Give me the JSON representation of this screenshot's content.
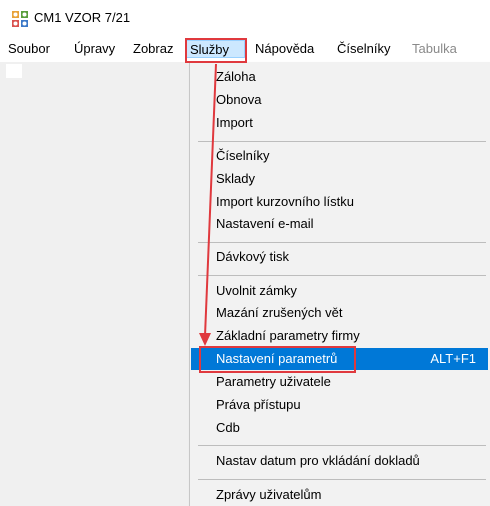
{
  "window": {
    "title": "CM1 VZOR 7/21",
    "icon": "app-grid-icon"
  },
  "menubar": {
    "items": [
      {
        "label": "Soubor",
        "state": "normal"
      },
      {
        "label": "Úpravy",
        "state": "normal"
      },
      {
        "label": "Zobraz",
        "state": "normal"
      },
      {
        "label": "Služby",
        "state": "open"
      },
      {
        "label": "Nápověda",
        "state": "normal"
      },
      {
        "label": "Číselníky",
        "state": "normal"
      },
      {
        "label": "Tabulka",
        "state": "disabled"
      }
    ]
  },
  "dropdown": {
    "groups": [
      [
        {
          "label": "Záloha"
        },
        {
          "label": "Obnova"
        },
        {
          "label": "Import"
        }
      ],
      [
        {
          "label": "Číselníky"
        },
        {
          "label": "Sklady"
        },
        {
          "label": "Import kurzovního lístku"
        },
        {
          "label": "Nastavení e-mail"
        }
      ],
      [
        {
          "label": "Dávkový tisk"
        }
      ],
      [
        {
          "label": "Uvolnit zámky"
        },
        {
          "label": "Mazání zrušených vět"
        },
        {
          "label": "Základní parametry firmy"
        },
        {
          "label": "Nastavení parametrů",
          "shortcut": "ALT+F1",
          "selected": true
        },
        {
          "label": "Parametry uživatele"
        },
        {
          "label": "Práva přístupu"
        },
        {
          "label": "Cdb"
        }
      ],
      [
        {
          "label": "Nastav datum pro vkládání dokladů"
        }
      ],
      [
        {
          "label": "Zprávy uživatelům"
        }
      ]
    ]
  },
  "annotation": {
    "color": "#e0393e",
    "arrow": "from Služby menu to Nastavení parametrů"
  }
}
